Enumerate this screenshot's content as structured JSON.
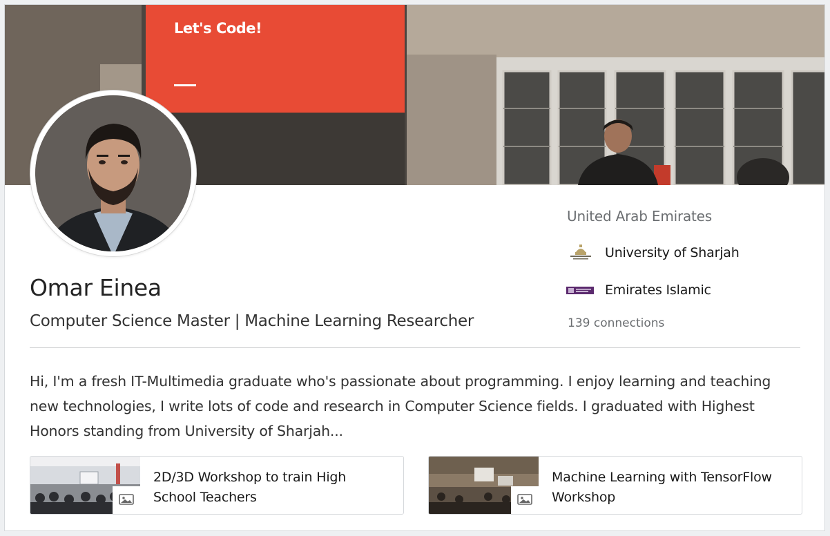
{
  "cover": {
    "slide_title": "Let's Code!"
  },
  "profile": {
    "name": "Omar Einea",
    "headline": "Computer Science Master | Machine Learning Researcher",
    "location": "United Arab Emirates",
    "connections": "139 connections",
    "summary": "Hi, I'm a fresh IT-Multimedia graduate who's passionate about programming. I enjoy learning and teaching new technologies, I write lots of code and research in Computer Science fields. I graduated with Highest Honors standing from University of Sharjah..."
  },
  "organizations": [
    {
      "label": "University of Sharjah",
      "logo": "university-of-sharjah-logo"
    },
    {
      "label": "Emirates Islamic",
      "logo": "emirates-islamic-logo"
    }
  ],
  "media": [
    {
      "title": "2D/3D Workshop to train High School Teachers",
      "icon": "image-icon"
    },
    {
      "title": "Machine Learning with TensorFlow Workshop",
      "icon": "image-icon"
    }
  ],
  "colors": {
    "slide_red": "#e84b35",
    "text_primary": "#191919",
    "text_secondary": "#6b6e71",
    "emirates_islamic_purple": "#5b2a6e"
  }
}
